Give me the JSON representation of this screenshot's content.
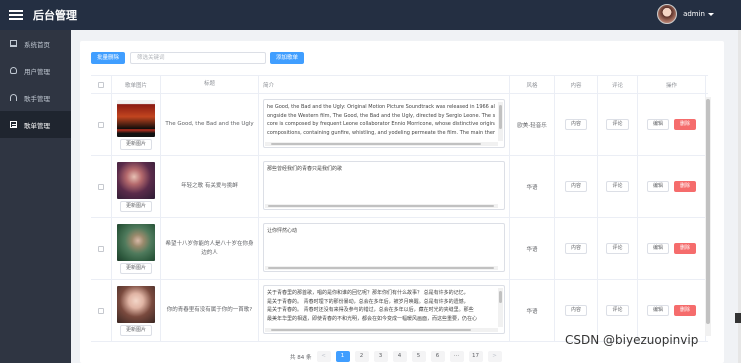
{
  "app": {
    "title": "后台管理"
  },
  "user": {
    "name": "admin"
  },
  "sidebar": {
    "items": [
      {
        "label": "系统首页",
        "icon": "dashboard-icon",
        "active": false
      },
      {
        "label": "用户管理",
        "icon": "user-icon",
        "active": false
      },
      {
        "label": "歌手管理",
        "icon": "headphones-icon",
        "active": false
      },
      {
        "label": "歌单管理",
        "icon": "document-icon",
        "active": true
      }
    ]
  },
  "toolbar": {
    "batch_delete_label": "批量删除",
    "search_placeholder": "筛选关键词",
    "add_label": "添加歌单"
  },
  "table": {
    "headers": {
      "cover": "歌单图片",
      "title": "标题",
      "intro": "简介",
      "style": "风格",
      "content": "内容",
      "comment": "评论",
      "ops": "操作"
    },
    "update_image_label": "更新图片",
    "content_label": "内容",
    "comment_label": "评论",
    "edit_label": "编辑",
    "delete_label": "删除",
    "rows": [
      {
        "title": "The Good, the Bad and the Ugly",
        "intro": "he Good, the Bad and the Ugly: Original Motion Picture Soundtrack was released in 1966 al\nongside the Western film, The Good, the Bad and the Ugly, directed by Sergio Leone. The s\ncore is composed by frequent Leone collaborator Ennio Morricone, whose distinctive original\ncompositions, containing gunfire, whistling, and yodeling permeate the film. The main them",
        "style": "欧美-轻音乐"
      },
      {
        "title": "年轻之歌 有关爱与挑衅",
        "intro": "那些曾经我们的青春只是我们的歌",
        "style": "华语"
      },
      {
        "title": "希望十八岁你能的人是八十岁在你身边的人",
        "intro": "让你怦然心动",
        "style": "华语"
      },
      {
        "title": "你的青春里有没有属于你的一首歌?",
        "intro": "关于青春里的那首歌，唱的是你和谁的回忆呢？那年你们有什么故事？ 总是有许多的记忆，\n是关于青春的。 青春时埋下的那份暴动，总会在多年后，被岁月唤醒。总是有许多的遗憾，\n是关于青春的。 青春时还没有来得及参与的错过，总会在多年以后，藏在时光的夹缝里。那些\n最美年华里的相遇，即使青春的不和光明，都会在如今变成一幅暖风画面，而这些重要，仍在心",
        "style": "华语"
      }
    ]
  },
  "pagination": {
    "total": "共 84 条",
    "prev": "<",
    "next": ">",
    "pages": [
      "1",
      "2",
      "3",
      "4",
      "5",
      "6",
      "···",
      "17"
    ],
    "current": "1"
  },
  "watermark": "CSDN @biyezuopinvip",
  "colors": {
    "header_bg": "#242f42",
    "sidebar_bg": "#2f3542",
    "primary": "#409eff",
    "danger": "#f56c6c"
  }
}
